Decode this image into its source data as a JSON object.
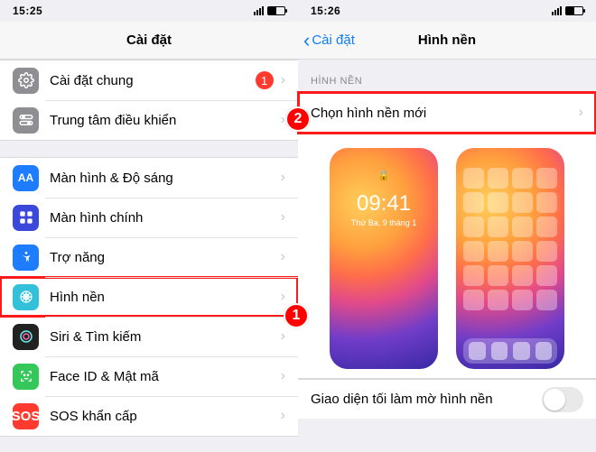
{
  "left": {
    "status": {
      "time": "15:25"
    },
    "header": {
      "title": "Cài đặt"
    },
    "rows": [
      {
        "key": "general",
        "label": "Cài đặt chung",
        "badge": "1"
      },
      {
        "key": "control",
        "label": "Trung tâm điều khiển"
      },
      {
        "key": "display",
        "label": "Màn hình & Độ sáng",
        "icon_text": "AA"
      },
      {
        "key": "home",
        "label": "Màn hình chính"
      },
      {
        "key": "access",
        "label": "Trợ năng"
      },
      {
        "key": "wallpaper",
        "label": "Hình nền"
      },
      {
        "key": "siri",
        "label": "Siri & Tìm kiếm"
      },
      {
        "key": "faceid",
        "label": "Face ID & Mật mã"
      },
      {
        "key": "sos",
        "label": "SOS khẩn cấp",
        "icon_text": "SOS"
      }
    ]
  },
  "right": {
    "status": {
      "time": "15:26"
    },
    "header": {
      "back": "Cài đặt",
      "title": "Hình nền"
    },
    "group_header": "HÌNH NỀN",
    "choose_label": "Chọn hình nền mới",
    "lock_preview": {
      "time": "09:41",
      "date": "Thứ Ba, 9 tháng 1"
    },
    "dark_mode_label": "Giao diện tối làm mờ hình nền"
  },
  "callouts": {
    "one": "1",
    "two": "2"
  }
}
